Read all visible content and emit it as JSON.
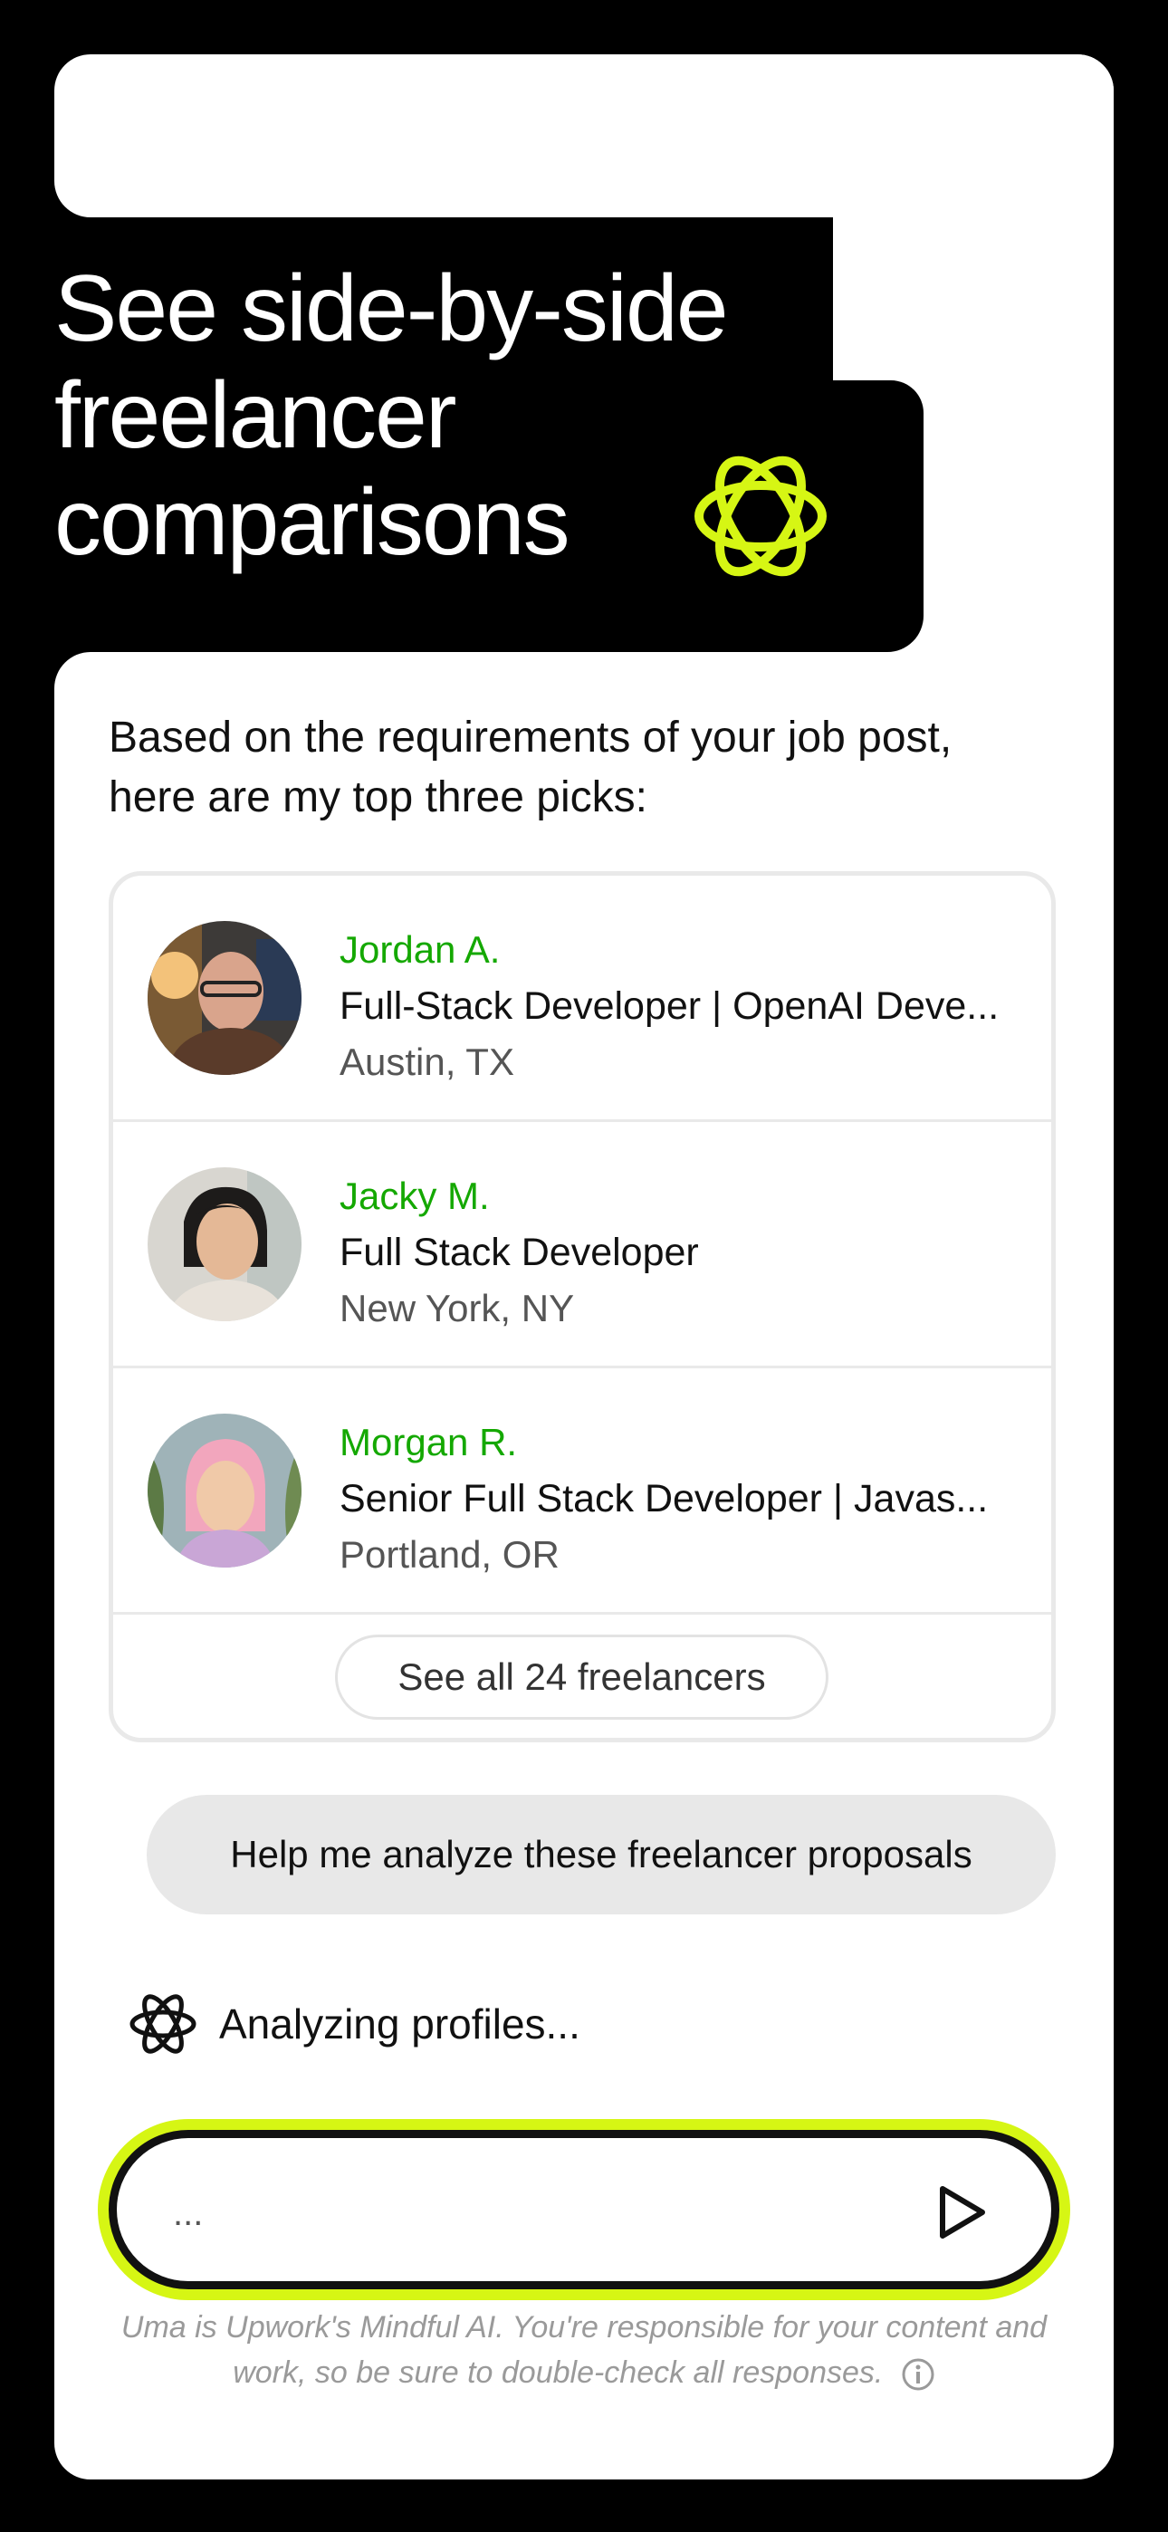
{
  "headline": "See side-by-side freelancer comparisons",
  "assistant": {
    "intro": "Based on the requirements of your job post, here are my top three picks:",
    "freelancers": [
      {
        "name": "Jordan A.",
        "role": "Full-Stack Developer | OpenAI Deve...",
        "location": "Austin, TX"
      },
      {
        "name": "Jacky M.",
        "role": "Full Stack Developer",
        "location": "New York, NY"
      },
      {
        "name": "Morgan R.",
        "role": "Senior Full Stack Developer | Javas...",
        "location": "Portland, OR"
      }
    ],
    "see_all_label": "See all 24 freelancers",
    "status": "Analyzing profiles..."
  },
  "user_message": "Help me analyze these freelancer proposals",
  "composer": {
    "placeholder": "..."
  },
  "disclaimer": "Uma is Upwork's Mindful AI. You're responsible for your content and work, so be sure to double-check all responses.",
  "colors": {
    "accent_green": "#14a800",
    "lime": "#d6f614"
  }
}
